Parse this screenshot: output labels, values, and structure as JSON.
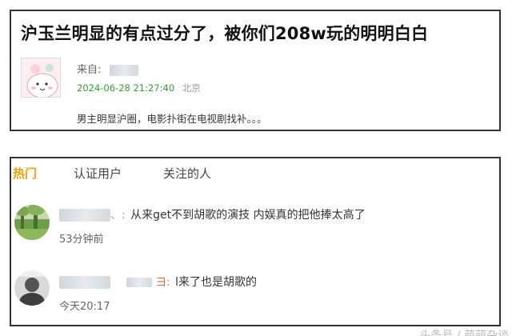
{
  "post": {
    "title": "沪玉兰明显的有点过分了，被你们208w玩的明明白白",
    "from_label": "来自:",
    "timestamp": "2024-06-28 21:27:40",
    "location": "北京",
    "body": "男主明显沪圈，电影扑街在电视剧找补。。。"
  },
  "comments_section": {
    "tabs": [
      {
        "label": "热门",
        "active": true
      },
      {
        "label": "认证用户",
        "active": false
      },
      {
        "label": "关注的人",
        "active": false
      }
    ],
    "comments": [
      {
        "name_suffix": "、:",
        "text": "从来get不到胡歌的演技 内娱真的把他捧太高了",
        "time": "53分钟前"
      },
      {
        "name_suffix": ":",
        "text": "l来了也是胡歌的",
        "time": "今天20:17"
      }
    ]
  },
  "colors": {
    "accent_active_tab": "#f0a000",
    "timestamp_green": "#3a9a3a",
    "border": "#333333"
  },
  "watermark": "头条号 / 萌萌杂谈"
}
